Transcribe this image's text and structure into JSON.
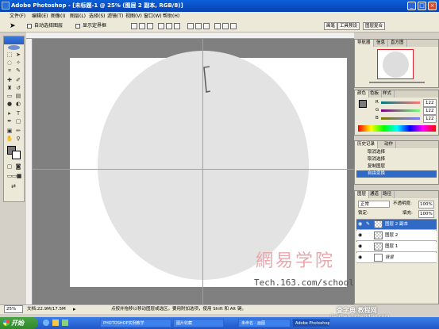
{
  "window": {
    "title": "Adobe Photoshop - [未标题-1 @ 25% (图层 2 副本, RGB/8)]"
  },
  "menu": [
    "文件(F)",
    "编辑(E)",
    "图像(I)",
    "图层(L)",
    "选择(S)",
    "滤镜(T)",
    "视图(V)",
    "窗口(W)",
    "帮助(H)"
  ],
  "options": {
    "auto_select": "自动选择图层",
    "show_bounds": "显示定界框"
  },
  "dock_tabs": [
    "画笔",
    "工具预设",
    "图层复合"
  ],
  "navigator": {
    "tabs": [
      "导航器",
      "信息",
      "直方图"
    ]
  },
  "color": {
    "tabs": [
      "颜色",
      "色板",
      "样式"
    ],
    "channels": [
      {
        "name": "R",
        "value": "122"
      },
      {
        "name": "G",
        "value": "122"
      },
      {
        "name": "B",
        "value": "122"
      }
    ]
  },
  "history": {
    "tabs": [
      "历史记录",
      "动作"
    ],
    "items": [
      "取消选择",
      "取消选择",
      "复制图层",
      "自由变换"
    ]
  },
  "layers": {
    "tabs": [
      "图层",
      "通道",
      "路径"
    ],
    "blend_mode": "正常",
    "opacity_label": "不透明度:",
    "opacity": "100%",
    "lock_label": "锁定:",
    "fill_label": "填充:",
    "fill": "100%",
    "items": [
      "图层 2 副本",
      "图层 2",
      "图层 1",
      "背景"
    ]
  },
  "status": {
    "zoom": "25%",
    "doc": "文档:22.9M/17.5M",
    "hint": "点按并拖移以移动图层或选区。要用附加选项，使用 Shift 和 Alt 键。"
  },
  "watermark": {
    "site": "Tech.163.com/school",
    "logo_text": "網易学院",
    "corner": "查字典 教程网",
    "corner_url": "jiaocheng.chazidian.com"
  },
  "taskbar": {
    "start": "开始",
    "tasks": [
      "PHOTOSHOP实例教学",
      "图片收藏",
      "未命名 - 画图",
      "Adobe Photoshop ..."
    ]
  }
}
